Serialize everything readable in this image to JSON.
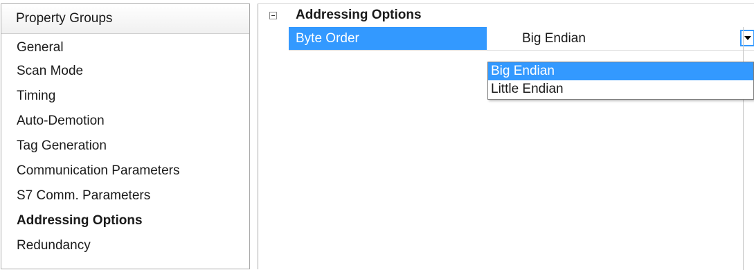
{
  "property_groups": {
    "header": "Property Groups",
    "items": [
      {
        "label": "General"
      },
      {
        "label": "Scan Mode"
      },
      {
        "label": "Timing"
      },
      {
        "label": "Auto-Demotion"
      },
      {
        "label": "Tag Generation"
      },
      {
        "label": "Communication Parameters"
      },
      {
        "label": "S7 Comm. Parameters"
      },
      {
        "label": "Addressing Options"
      },
      {
        "label": "Redundancy"
      }
    ],
    "selected": "Addressing Options"
  },
  "grid": {
    "category": "Addressing Options",
    "property": {
      "name": "Byte Order",
      "value": "Big Endian"
    },
    "dropdown": {
      "options": [
        "Big Endian",
        "Little Endian"
      ],
      "highlighted": "Big Endian"
    }
  },
  "colors": {
    "selection": "#3399ff",
    "border": "#a9a9a9"
  }
}
